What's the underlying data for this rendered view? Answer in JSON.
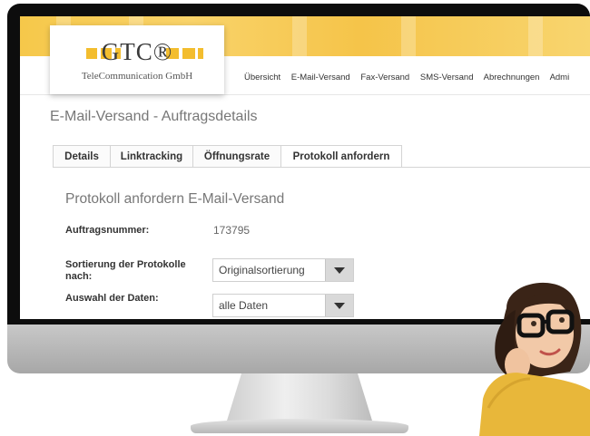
{
  "logo": {
    "brand": "GTC®",
    "subtitle": "TeleCommunication GmbH"
  },
  "nav": {
    "items": [
      "Übersicht",
      "E-Mail-Versand",
      "Fax-Versand",
      "SMS-Versand",
      "Abrechnungen",
      "Admi"
    ]
  },
  "page": {
    "title": "E-Mail-Versand - Auftragsdetails"
  },
  "tabs": [
    {
      "label": "Details"
    },
    {
      "label": "Linktracking"
    },
    {
      "label": "Öffnungsrate"
    },
    {
      "label": "Protokoll anfordern",
      "active": true
    }
  ],
  "panel": {
    "title": "Protokoll anfordern E-Mail-Versand",
    "order_label": "Auftragsnummer:",
    "order_value": "173795",
    "sort_label": "Sortierung der Protokolle nach:",
    "sort_value": "Originalsortierung",
    "data_label": "Auswahl der Daten:",
    "data_value": "alle Daten"
  },
  "colors": {
    "brand_yellow": "#f3bd2e",
    "bezel": "#0d0d0d"
  }
}
